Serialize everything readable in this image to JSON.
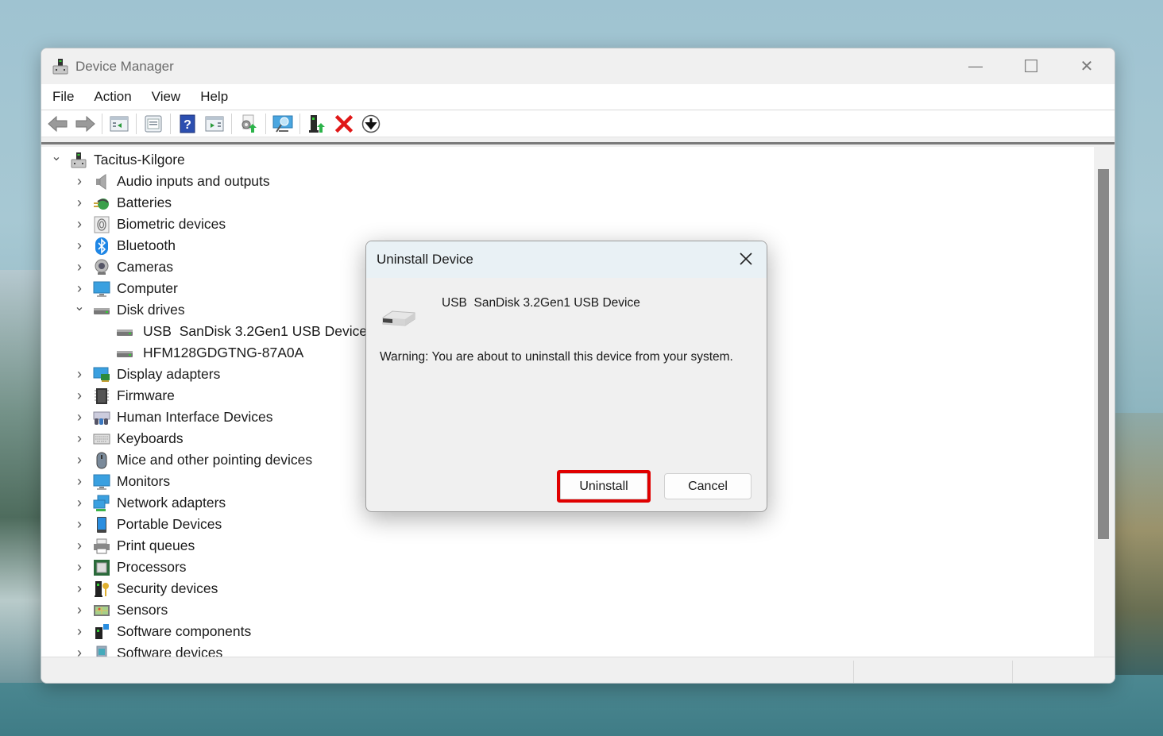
{
  "window": {
    "title": "Device Manager",
    "controls": {
      "minimize": "—",
      "maximize": "☐",
      "close": "✕"
    }
  },
  "menubar": [
    "File",
    "Action",
    "View",
    "Help"
  ],
  "toolbar": [
    {
      "name": "back-button",
      "icon": "back-arrow-icon"
    },
    {
      "name": "forward-button",
      "icon": "forward-arrow-icon"
    },
    {
      "name": "show-hide-console-tree-button",
      "icon": "console-tree-icon"
    },
    {
      "name": "properties-button",
      "icon": "properties-icon"
    },
    {
      "name": "help-button",
      "icon": "help-icon",
      "glyph": "?"
    },
    {
      "name": "show-action-pane-button",
      "icon": "action-pane-icon"
    },
    {
      "name": "update-driver-button",
      "icon": "update-driver-icon"
    },
    {
      "name": "scan-hardware-button",
      "icon": "scan-hardware-icon"
    },
    {
      "name": "enable-device-button",
      "icon": "enable-device-icon"
    },
    {
      "name": "uninstall-device-button",
      "icon": "uninstall-x-icon",
      "glyph": "✕"
    },
    {
      "name": "disable-device-button",
      "icon": "download-arrow-icon",
      "glyph": "⬇"
    }
  ],
  "tree": {
    "root": {
      "label": "Tacitus-Kilgore",
      "expanded": true
    },
    "categories": [
      {
        "label": "Audio inputs and outputs",
        "icon": "speaker-icon",
        "expanded": false
      },
      {
        "label": "Batteries",
        "icon": "battery-icon",
        "expanded": false
      },
      {
        "label": "Biometric devices",
        "icon": "fingerprint-icon",
        "expanded": false
      },
      {
        "label": "Bluetooth",
        "icon": "bluetooth-icon",
        "expanded": false
      },
      {
        "label": "Cameras",
        "icon": "webcam-icon",
        "expanded": false
      },
      {
        "label": "Computer",
        "icon": "monitor-icon",
        "expanded": false
      },
      {
        "label": "Disk drives",
        "icon": "disk-drive-icon",
        "expanded": true,
        "children": [
          "USB  SanDisk 3.2Gen1 USB Device",
          "HFM128GDGTNG-87A0A"
        ]
      },
      {
        "label": "Display adapters",
        "icon": "display-adapter-icon",
        "expanded": false
      },
      {
        "label": "Firmware",
        "icon": "chip-icon",
        "expanded": false
      },
      {
        "label": "Human Interface Devices",
        "icon": "hid-icon",
        "expanded": false
      },
      {
        "label": "Keyboards",
        "icon": "keyboard-icon",
        "expanded": false
      },
      {
        "label": "Mice and other pointing devices",
        "icon": "mouse-icon",
        "expanded": false
      },
      {
        "label": "Monitors",
        "icon": "monitor-icon",
        "expanded": false
      },
      {
        "label": "Network adapters",
        "icon": "network-icon",
        "expanded": false
      },
      {
        "label": "Portable Devices",
        "icon": "portable-device-icon",
        "expanded": false
      },
      {
        "label": "Print queues",
        "icon": "printer-icon",
        "expanded": false
      },
      {
        "label": "Processors",
        "icon": "processor-icon",
        "expanded": false
      },
      {
        "label": "Security devices",
        "icon": "security-key-icon",
        "expanded": false
      },
      {
        "label": "Sensors",
        "icon": "sensor-icon",
        "expanded": false
      },
      {
        "label": "Software components",
        "icon": "software-component-icon",
        "expanded": false
      },
      {
        "label": "Software devices",
        "icon": "software-device-icon",
        "expanded": false
      }
    ]
  },
  "dialog": {
    "title": "Uninstall Device",
    "device_name": "USB  SanDisk 3.2Gen1 USB Device",
    "warning": "Warning: You are about to uninstall this device from your system.",
    "buttons": {
      "uninstall": "Uninstall",
      "cancel": "Cancel"
    },
    "highlight_color": "#e00000"
  },
  "colors": {
    "window_bg": "#f0f0f0",
    "content_bg": "#ffffff",
    "dialog_title_bg": "#e9f1f5",
    "scroll_thumb": "#888888"
  }
}
